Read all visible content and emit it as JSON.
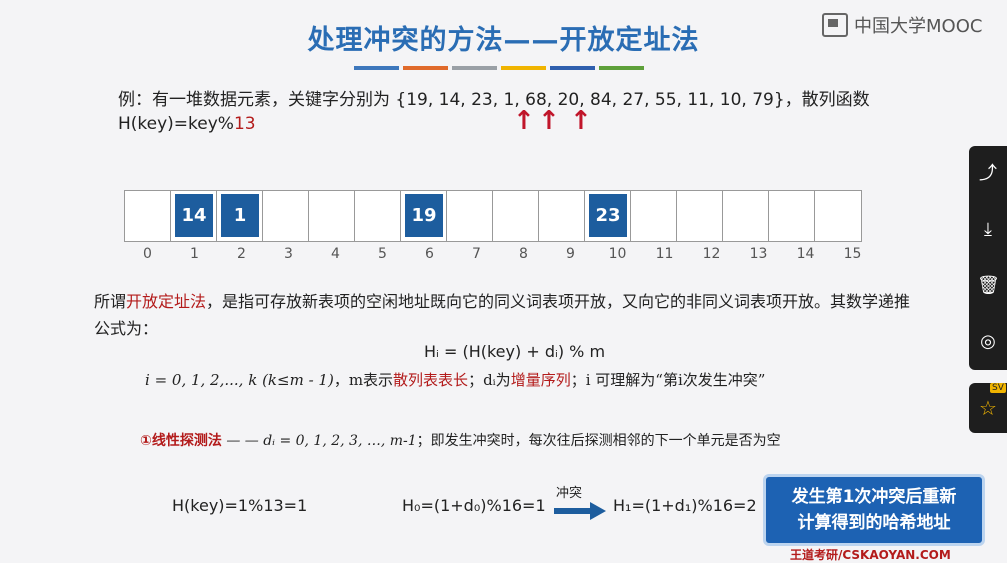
{
  "title": "处理冲突的方法——开放定址法",
  "logo_text": "中国大学MOOC",
  "color_bars": [
    "#3d77bc",
    "#e06a2b",
    "#9aa0a6",
    "#f0b400",
    "#2f5fae",
    "#5ea03a"
  ],
  "example": {
    "line1": "例：有一堆数据元素，关键字分别为 {19, 14, 23, 1, 68, 20, 84, 27, 55, 11, 10, 79}，散列函数",
    "line2_prefix": "H(key)=key%",
    "line2_mod": "13"
  },
  "table": {
    "cells": [
      "",
      "14",
      "1",
      "",
      "",
      "",
      "19",
      "",
      "",
      "",
      "23",
      "",
      "",
      "",
      "",
      ""
    ],
    "indices": [
      "0",
      "1",
      "2",
      "3",
      "4",
      "5",
      "6",
      "7",
      "8",
      "9",
      "10",
      "11",
      "12",
      "13",
      "14",
      "15"
    ]
  },
  "description": {
    "pre": "所谓",
    "term": "开放定址法",
    "post": "，是指可存放新表项的空闲地址既向它的同义词表项开放，又向它的非同义词表项开放。其数学递推公式为："
  },
  "formula_hi": "Hᵢ = (H(key) + dᵢ) % m",
  "formula_params": {
    "range": "i = 0, 1, 2,..., k  (k≤m - 1)",
    "m_pre": "，m表示",
    "m_term": "散列表表长",
    "d_pre": "；dᵢ为",
    "d_term": "增量序列",
    "i_text": "；i 可理解为“第i次发生冲突”"
  },
  "linear_probe": {
    "label": "①线性探测法",
    "formula": "— — dᵢ = 0, 1, 2, 3, …, m-1",
    "desc": "；即发生冲突时，每次往后探测相邻的下一个单元是否为空"
  },
  "computation": {
    "eq1": "H(key)=1%13=1",
    "eq2": "H₀=(1+d₀)%16=1",
    "conflict_label": "冲突",
    "eq3": "H₁=(1+d₁)%16=2"
  },
  "callout": {
    "line1": "发生第1次冲突后重新",
    "line2": "计算得到的哈希地址"
  },
  "footer": "王道考研/CSKAOYAN.COM",
  "sidebar_icons": [
    "share-icon",
    "download-icon",
    "delete-icon",
    "view-icon",
    "pin-icon"
  ],
  "sidebar_badge": "SV"
}
